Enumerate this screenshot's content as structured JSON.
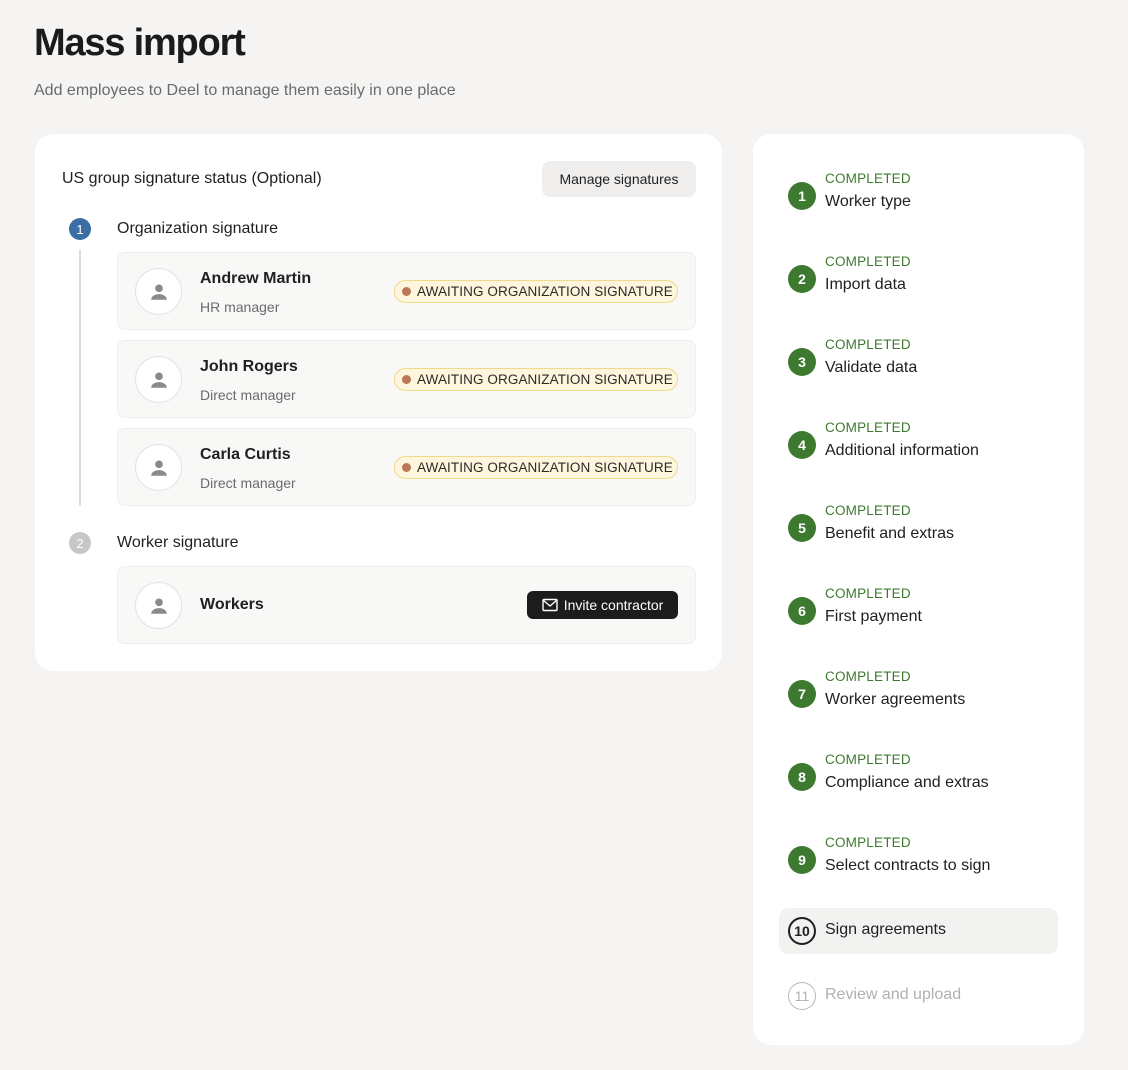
{
  "header": {
    "title": "Mass import",
    "subtitle": "Add employees to Deel to manage them easily in one place"
  },
  "signature_panel": {
    "title": "US group signature status (Optional)",
    "manage_button": "Manage signatures",
    "groups": [
      {
        "number": "1",
        "label": "Organization signature",
        "signers": [
          {
            "name": "Andrew Martin",
            "role": "HR manager",
            "status": "AWAITING ORGANIZATION SIGNATURE"
          },
          {
            "name": "John Rogers",
            "role": "Direct manager",
            "status": "AWAITING ORGANIZATION SIGNATURE"
          },
          {
            "name": "Carla Curtis",
            "role": "Direct manager",
            "status": "AWAITING ORGANIZATION SIGNATURE"
          }
        ]
      },
      {
        "number": "2",
        "label": "Worker signature",
        "signers": [
          {
            "name": "Workers",
            "action": "Invite contractor"
          }
        ]
      }
    ]
  },
  "steps": [
    {
      "number": "1",
      "status": "COMPLETED",
      "label": "Worker type"
    },
    {
      "number": "2",
      "status": "COMPLETED",
      "label": "Import data"
    },
    {
      "number": "3",
      "status": "COMPLETED",
      "label": "Validate data"
    },
    {
      "number": "4",
      "status": "COMPLETED",
      "label": "Additional information"
    },
    {
      "number": "5",
      "status": "COMPLETED",
      "label": "Benefit and extras"
    },
    {
      "number": "6",
      "status": "COMPLETED",
      "label": "First payment"
    },
    {
      "number": "7",
      "status": "COMPLETED",
      "label": "Worker agreements"
    },
    {
      "number": "8",
      "status": "COMPLETED",
      "label": "Compliance and extras"
    },
    {
      "number": "9",
      "status": "COMPLETED",
      "label": "Select contracts to sign"
    },
    {
      "number": "10",
      "status": "",
      "label": "Sign agreements"
    },
    {
      "number": "11",
      "status": "",
      "label": "Review and upload"
    }
  ],
  "icons": {
    "avatar": "person-icon",
    "invite": "mail-icon"
  },
  "colors": {
    "completed": "#3d7a30",
    "active_group": "#3a6ea5",
    "badge_background": "#fdf6dc",
    "badge_dot": "#b9785c"
  }
}
